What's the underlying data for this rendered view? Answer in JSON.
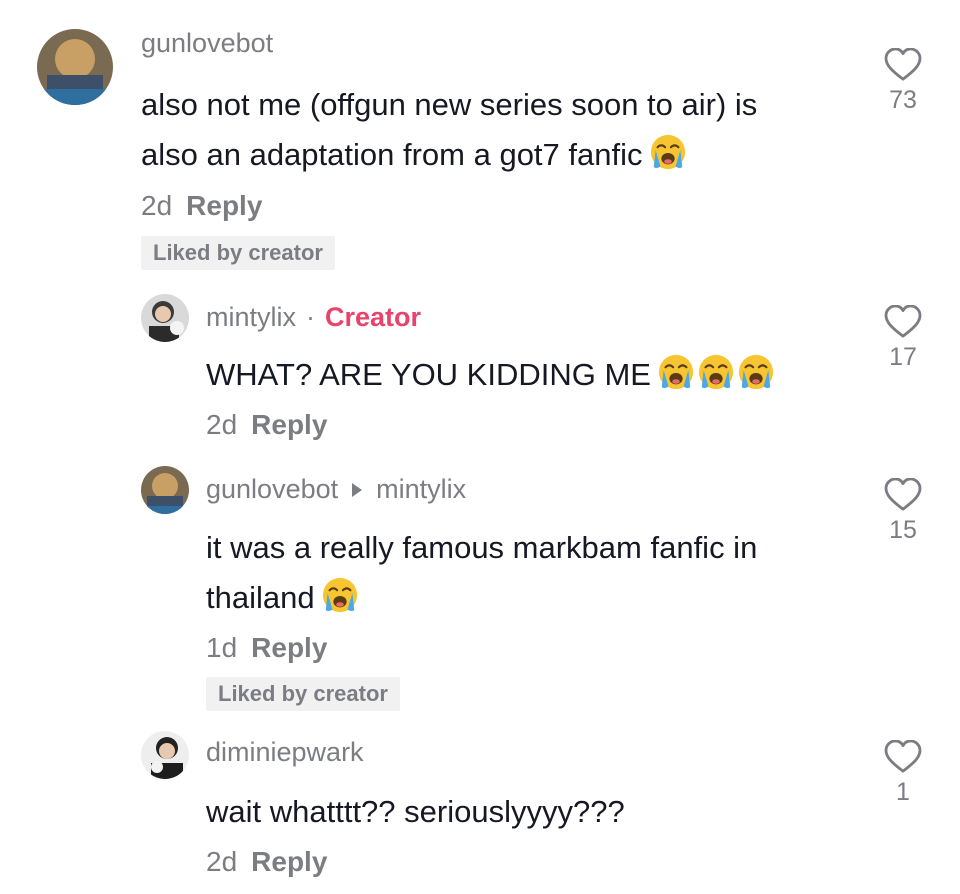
{
  "comments": [
    {
      "username": "gunlovebot",
      "text_lines": [
        "also not me (offgun new series soon to air) is",
        "also an adaptation from a got7 fanfic"
      ],
      "emoji": "crying-emoji",
      "time": "2d",
      "reply_label": "Reply",
      "liked_badge": "Liked by creator",
      "likes": "73"
    },
    {
      "username": "mintylix",
      "dot": "·",
      "creator_label": "Creator",
      "text": "WHAT? ARE YOU KIDDING ME",
      "emoji": "crying-emoji",
      "time": "2d",
      "reply_label": "Reply",
      "likes": "17"
    },
    {
      "username": "gunlovebot",
      "reply_to": "mintylix",
      "text_lines": [
        "it was a really famous markbam fanfic in",
        "thailand"
      ],
      "emoji": "crying-emoji",
      "time": "1d",
      "reply_label": "Reply",
      "liked_badge": "Liked by creator",
      "likes": "15"
    },
    {
      "username": "diminiepwark",
      "text": "wait whatttt?? seriouslyyyy???",
      "time": "2d",
      "reply_label": "Reply",
      "likes": "1"
    }
  ],
  "colors": {
    "creator": "#e8436a",
    "secondary_text": "#7c7d83",
    "primary_text": "#161823",
    "badge_bg": "#f1f1f2"
  }
}
